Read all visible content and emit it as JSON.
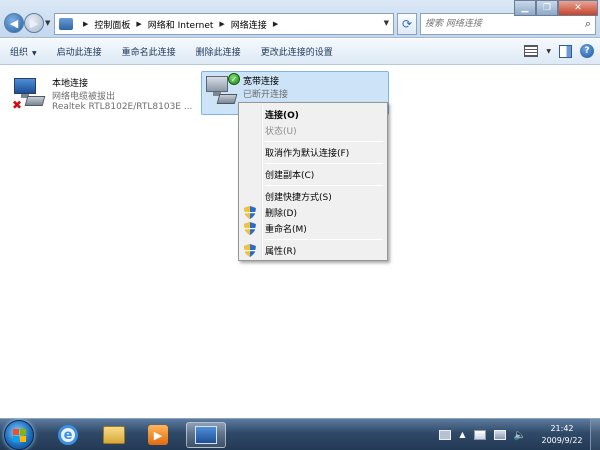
{
  "nav": {
    "back_icon": "back-arrow-icon",
    "forward_icon": "forward-arrow-icon"
  },
  "address": {
    "crumbs": [
      "控制面板",
      "网络和 Internet",
      "网络连接"
    ]
  },
  "search": {
    "placeholder": "搜索 网络连接"
  },
  "cmdbar": {
    "organize": "组织",
    "enable": "启动此连接",
    "rename": "重命名此连接",
    "delete": "删除此连接",
    "settings": "更改此连接的设置"
  },
  "connections": {
    "local": {
      "name": "本地连接",
      "status": "网络电缆被拔出",
      "device": "Realtek RTL8102E/RTL8103E ..."
    },
    "broadband": {
      "name": "宽带连接",
      "status": "已断开连接"
    }
  },
  "menu": {
    "connect": "连接(O)",
    "status": "状态(U)",
    "cancel_default": "取消作为默认连接(F)",
    "copy": "创建副本(C)",
    "shortcut": "创建快捷方式(S)",
    "delete": "删除(D)",
    "rename": "重命名(M)",
    "properties": "属性(R)"
  },
  "taskbar": {
    "time": "21:42",
    "date": "2009/9/22"
  },
  "colors": {
    "selection": "#cde3f7",
    "taskbar": "#2f4968",
    "close_button": "#c4452c"
  }
}
